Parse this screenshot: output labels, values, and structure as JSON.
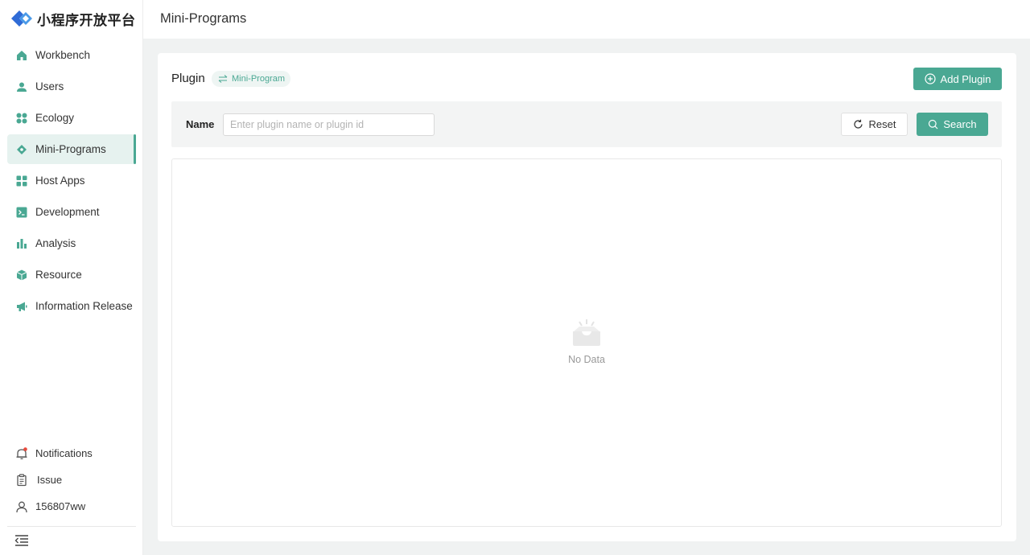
{
  "app": {
    "logo_text": "小程序开放平台"
  },
  "sidebar": {
    "items": [
      {
        "label": "Workbench",
        "icon": "home-icon"
      },
      {
        "label": "Users",
        "icon": "user-icon"
      },
      {
        "label": "Ecology",
        "icon": "dots-grid-icon"
      },
      {
        "label": "Mini-Programs",
        "icon": "diamond-icon",
        "active": true
      },
      {
        "label": "Host Apps",
        "icon": "apps-grid-icon"
      },
      {
        "label": "Development",
        "icon": "terminal-icon"
      },
      {
        "label": "Analysis",
        "icon": "bar-chart-icon"
      },
      {
        "label": "Resource",
        "icon": "cube-icon"
      },
      {
        "label": "Information Release",
        "icon": "megaphone-icon"
      }
    ],
    "bottom": {
      "notifications": "Notifications",
      "issue": "Issue",
      "user": "156807ww"
    }
  },
  "header": {
    "title": "Mini-Programs"
  },
  "card": {
    "title": "Plugin",
    "tag": "Mini-Program",
    "add_button": "Add Plugin"
  },
  "filter": {
    "name_label": "Name",
    "name_placeholder": "Enter plugin name or plugin id",
    "name_value": "",
    "reset_label": "Reset",
    "search_label": "Search"
  },
  "table": {
    "empty_text": "No Data"
  },
  "colors": {
    "accent": "#4aa893",
    "active_bg": "#e6f2ef",
    "notification_dot": "#e84a3c",
    "logo_blue": "#2f6bd6"
  }
}
